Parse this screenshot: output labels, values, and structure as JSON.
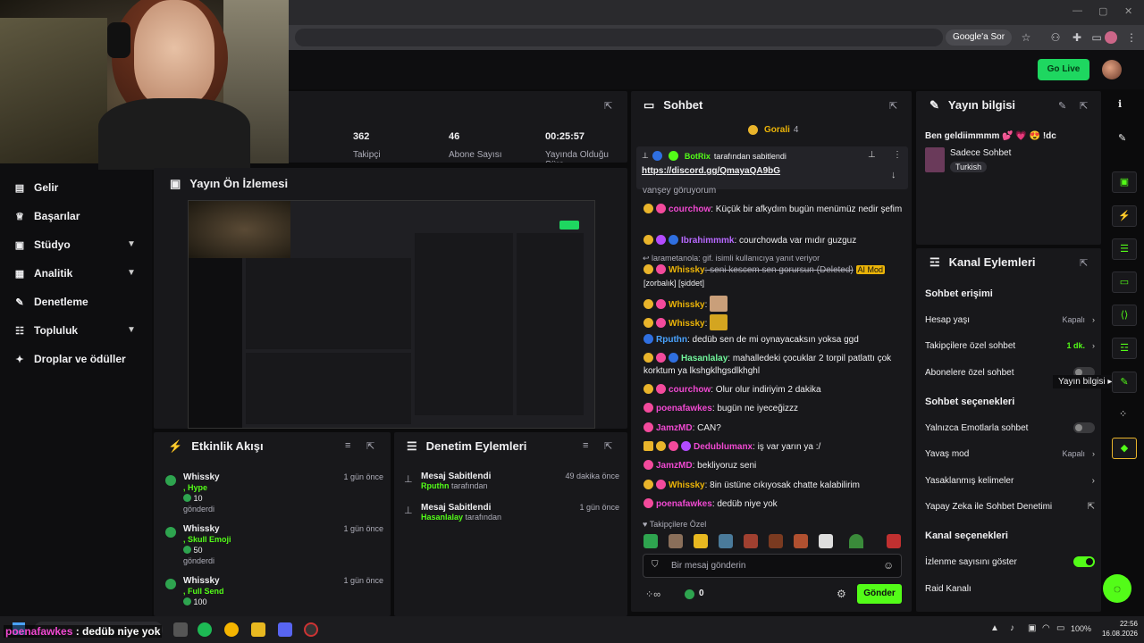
{
  "browser": {
    "google_sor": "Google'a Sor"
  },
  "topbar": {
    "go_live": "Go Live"
  },
  "stats": [
    {
      "value": "362",
      "label": "Takipçi"
    },
    {
      "value": "46",
      "label": "Abone Sayısı"
    },
    {
      "value": "00:25:57",
      "label": "Yayında Olduğu Süre"
    }
  ],
  "sidebar": {
    "items": [
      {
        "label": "Gelir",
        "icon": "wallet-icon"
      },
      {
        "label": "Başarılar",
        "icon": "trophy-icon"
      },
      {
        "label": "Stüdyo",
        "icon": "studio-icon"
      },
      {
        "label": "Analitik",
        "icon": "chart-icon"
      },
      {
        "label": "Denetleme",
        "icon": "wrench-icon"
      },
      {
        "label": "Topluluk",
        "icon": "community-icon"
      },
      {
        "label": "Droplar ve ödüller",
        "icon": "gift-icon"
      }
    ]
  },
  "preview": {
    "title": "Yayın Ön İzlemesi"
  },
  "activity": {
    "title": "Etkinlik Akışı",
    "items": [
      {
        "user": "Whissky",
        "item": ", Hype",
        "amount": "10",
        "verb": "gönderdi",
        "time": "1 gün önce"
      },
      {
        "user": "Whissky",
        "item": ", Skull Emoji",
        "amount": "50",
        "verb": "gönderdi",
        "time": "1 gün önce"
      },
      {
        "user": "Whissky",
        "item": ", Full Send",
        "amount": "100",
        "verb": "",
        "time": "1 gün önce"
      }
    ]
  },
  "moderation": {
    "title": "Denetim Eylemleri",
    "items": [
      {
        "title": "Mesaj Sabitlendi",
        "user": "Rputhn",
        "suffix": " tarafından",
        "time": "49 dakika önce"
      },
      {
        "title": "Mesaj Sabitlendi",
        "user": "Hasanlalay",
        "suffix": " tarafından",
        "time": "1 gün önce"
      }
    ]
  },
  "chat": {
    "title": "Sohbet",
    "gorali": "Gorali",
    "gorali_count": "4",
    "pinned_by_user": "BotRix",
    "pinned_by_text": " tarafından sabitlendi",
    "pinned_link": "https://discord.gg/QmayaQA9bG",
    "cut_text": "vanşey göruyorum",
    "messages": [
      {
        "user": "courchow",
        "ucls": "u-pink",
        "text": ": Küçük bir afkydım bugün menümüz nedir şefim"
      },
      {
        "user": "Ibrahimmmk",
        "ucls": "u-purp",
        "text": ": courchowda var mıdır guzguz"
      },
      {
        "user": "Whissky",
        "ucls": "u-gold",
        "text": ": seni kescem sen gorursun (Deleted)"
      },
      {
        "user": "Whissky",
        "ucls": "u-gold",
        "text": ":"
      },
      {
        "user": "Whissky",
        "ucls": "u-gold",
        "text": ":"
      },
      {
        "user": "Rputhn",
        "ucls": "u-blue",
        "text": ": dedüb sen de mi oynayacaksın yoksa ggd"
      },
      {
        "user": "Hasanlalay",
        "ucls": "u-grn",
        "text": ": mahalledeki çocuklar 2 torpil patlattı çok korktum ya lkshgklhgsdlkhghl"
      },
      {
        "user": "courchow",
        "ucls": "u-pink",
        "text": ": Olur olur indiriyim 2 dakika"
      },
      {
        "user": "poenafawkes",
        "ucls": "u-pink",
        "text": ": bugün ne iyeceğizzz"
      },
      {
        "user": "JamzMD",
        "ucls": "u-pink",
        "text": ": CAN?"
      },
      {
        "user": "Dedublumanx",
        "ucls": "u-pink",
        "text": ": iş var yarın ya :/"
      },
      {
        "user": "JamzMD",
        "ucls": "u-pink",
        "text": ": bekliyoruz seni"
      },
      {
        "user": "Whissky",
        "ucls": "u-gold",
        "text": ": 8in üstüne cıkıyosak chatte kalabilirim"
      },
      {
        "user": "poenafawkes",
        "ucls": "u-pink",
        "text": ": dedüb niye yok"
      }
    ],
    "reply_note": "larametanola: gif. isimli kullanıcıya yanıt veriyor",
    "ai_mod": "AI Mod",
    "ai_tags": " [zorbalık] [şiddet]",
    "followers_only": "Takipçilere Özel",
    "input_placeholder": "Bir mesaj gönderin",
    "send": "Gönder",
    "points": "0"
  },
  "stream_info": {
    "title": "Yayın bilgisi",
    "stream_title": "Ben geldiimmmm 💕 💗 😍 !dc",
    "category": "Sadece Sohbet",
    "tag": "Turkish"
  },
  "channel_actions": {
    "title": "Kanal Eylemleri",
    "section1": "Sohbet erişimi",
    "rows1": [
      {
        "label": "Hesap yaşı",
        "value": "Kapalı"
      },
      {
        "label": "Takipçilere özel sohbet",
        "value": "1 dk."
      },
      {
        "label": "Abonelere özel sohbet",
        "value": ""
      }
    ],
    "section2": "Sohbet seçenekleri",
    "rows2": [
      {
        "label": "Yalnızca Emotlarla sohbet",
        "value": ""
      },
      {
        "label": "Yavaş mod",
        "value": "Kapalı"
      },
      {
        "label": "Yasaklanmış kelimeler",
        "value": ""
      },
      {
        "label": "Yapay Zeka ile Sohbet Denetimi",
        "value": ""
      }
    ],
    "section3": "Kanal seçenekleri",
    "rows3": [
      {
        "label": "İzlenme sayısını göster",
        "value": ""
      },
      {
        "label": "Raid Kanalı",
        "value": ""
      }
    ],
    "tooltip": "Yayın bilgisi"
  },
  "overlay": {
    "user": "poenafawkes",
    "text": " : dedüb niye yok"
  },
  "taskbar": {
    "time": "22:56",
    "date": "16.08.2026",
    "battery": "100%"
  }
}
